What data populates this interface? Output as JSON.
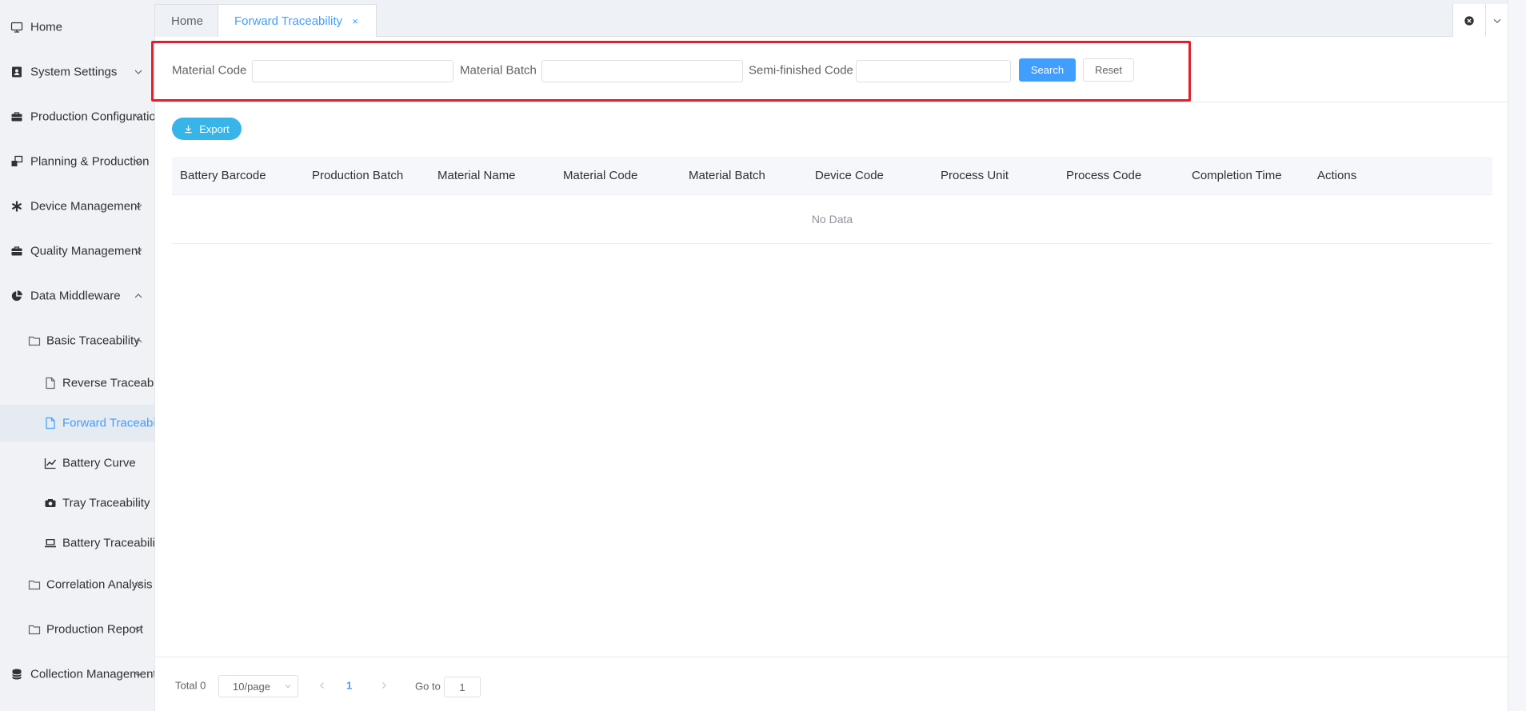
{
  "sidebar": {
    "items": [
      {
        "label": "Home",
        "icon": "monitor-icon",
        "level": 1,
        "arrow": ""
      },
      {
        "label": "System Settings",
        "icon": "user-card-icon",
        "level": 1,
        "arrow": "down"
      },
      {
        "label": "Production Configuration",
        "icon": "briefcase-icon",
        "level": 1,
        "arrow": "down"
      },
      {
        "label": "Planning & Production",
        "icon": "windows-icon",
        "level": 1,
        "arrow": "down"
      },
      {
        "label": "Device Management",
        "icon": "asterisk-icon",
        "level": 1,
        "arrow": "down"
      },
      {
        "label": "Quality Management",
        "icon": "briefcase-icon",
        "level": 1,
        "arrow": "down"
      },
      {
        "label": "Data Middleware",
        "icon": "pie-chart-icon",
        "level": 1,
        "arrow": "up"
      },
      {
        "label": "Basic Traceability",
        "icon": "folder-icon",
        "level": 2,
        "arrow": "up"
      },
      {
        "label": "Reverse Traceability",
        "icon": "document-icon",
        "level": 3,
        "arrow": ""
      },
      {
        "label": "Forward Traceability",
        "icon": "document-icon",
        "level": 3,
        "arrow": "",
        "active": true
      },
      {
        "label": "Battery Curve",
        "icon": "line-chart-icon",
        "level": 3,
        "arrow": ""
      },
      {
        "label": "Tray Traceability",
        "icon": "camera-icon",
        "level": 3,
        "arrow": ""
      },
      {
        "label": "Battery Traceability",
        "icon": "laptop-icon",
        "level": 3,
        "arrow": ""
      },
      {
        "label": "Correlation Analysis",
        "icon": "folder-icon",
        "level": 2,
        "arrow": "down"
      },
      {
        "label": "Production Report",
        "icon": "folder-icon",
        "level": 2,
        "arrow": "down"
      },
      {
        "label": "Collection Management",
        "icon": "database-icon",
        "level": 1,
        "arrow": "down"
      }
    ]
  },
  "tabs": {
    "home": "Home",
    "active": "Forward Traceability",
    "close_glyph": "×"
  },
  "search": {
    "material_code_label": "Material Code",
    "material_code_value": "",
    "material_batch_label": "Material Batch",
    "material_batch_value": "",
    "semi_finished_label": "Semi-finished Code",
    "semi_finished_value": "",
    "search_button": "Search",
    "reset_button": "Reset"
  },
  "toolbar": {
    "export_label": "Export"
  },
  "table": {
    "columns": [
      "Battery Barcode",
      "Production Batch",
      "Material Name",
      "Material Code",
      "Material Batch",
      "Device Code",
      "Process Unit",
      "Process Code",
      "Completion Time",
      "Actions"
    ],
    "empty_text": "No Data"
  },
  "pagination": {
    "total": "Total 0",
    "page_size": "10/page",
    "current_page": "1",
    "goto_label": "Go to",
    "goto_value": "1"
  },
  "colors": {
    "accent": "#409eff",
    "highlight": "#e0202a",
    "export": "#38b5e8"
  }
}
